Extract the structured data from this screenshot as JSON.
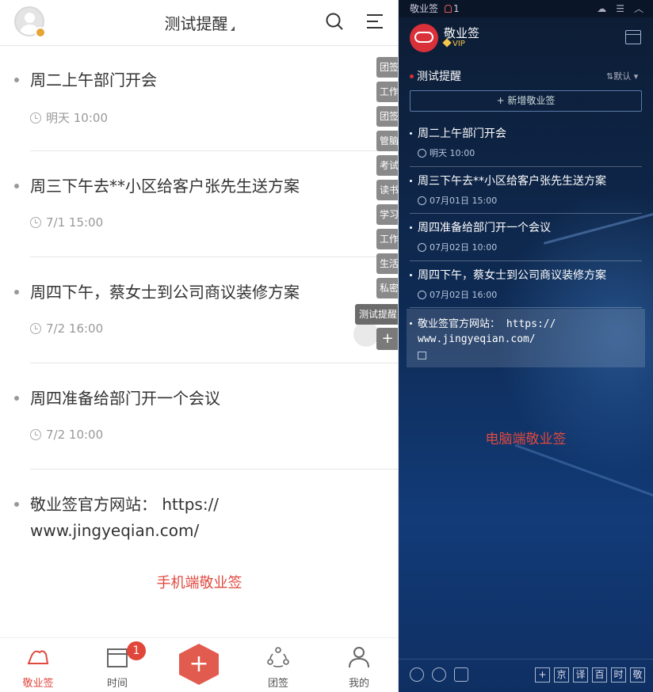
{
  "mobile": {
    "header": {
      "title": "测试提醒"
    },
    "items": [
      {
        "text": "周二上午部门开会",
        "time": "明天 10:00"
      },
      {
        "text": "周三下午去**小区给客户张先生送方案",
        "time": "7/1 15:00"
      },
      {
        "text": "周四下午，蔡女士到公司商议装修方案",
        "time": "7/2 16:00"
      },
      {
        "text": "周四准备给部门开一个会议",
        "time": "7/2 10:00"
      },
      {
        "text": "敬业签官方网站： https://\nwww.jingyeqian.com/",
        "time": ""
      }
    ],
    "caption": "手机端敬业签",
    "side_tabs": [
      "团签",
      "工作",
      "团签",
      "管脑",
      "考试",
      "读书",
      "学习",
      "工作",
      "生活",
      "私密"
    ],
    "active_tab": "测试提醒",
    "add_tab": "+",
    "nav": [
      {
        "label": "敬业签"
      },
      {
        "label": "时间"
      },
      {
        "label": ""
      },
      {
        "label": "团签"
      },
      {
        "label": "我的"
      }
    ],
    "badge": "1",
    "plus": "+"
  },
  "desktop": {
    "topbar": {
      "title": "敬业签",
      "count": "1"
    },
    "app_name": "敬业签",
    "vip": "VIP",
    "group": "测试提醒",
    "sort": "默认",
    "add_button": "+ 新增敬业签",
    "items": [
      {
        "text": "周二上午部门开会",
        "time": "明天 10:00"
      },
      {
        "text": "周三下午去**小区给客户张先生送方案",
        "time": "07月01日 15:00"
      },
      {
        "text": "周四准备给部门开一个会议",
        "time": "07月02日 10:00"
      },
      {
        "text": "周四下午，蔡女士到公司商议装修方案",
        "time": "07月02日 16:00"
      },
      {
        "text": "敬业签官方网站： https://\nwww.jingyeqian.com/",
        "time": ""
      }
    ],
    "caption": "电脑端敬业签",
    "keys": [
      "+",
      "京",
      "译",
      "百",
      "时",
      "敬"
    ]
  }
}
